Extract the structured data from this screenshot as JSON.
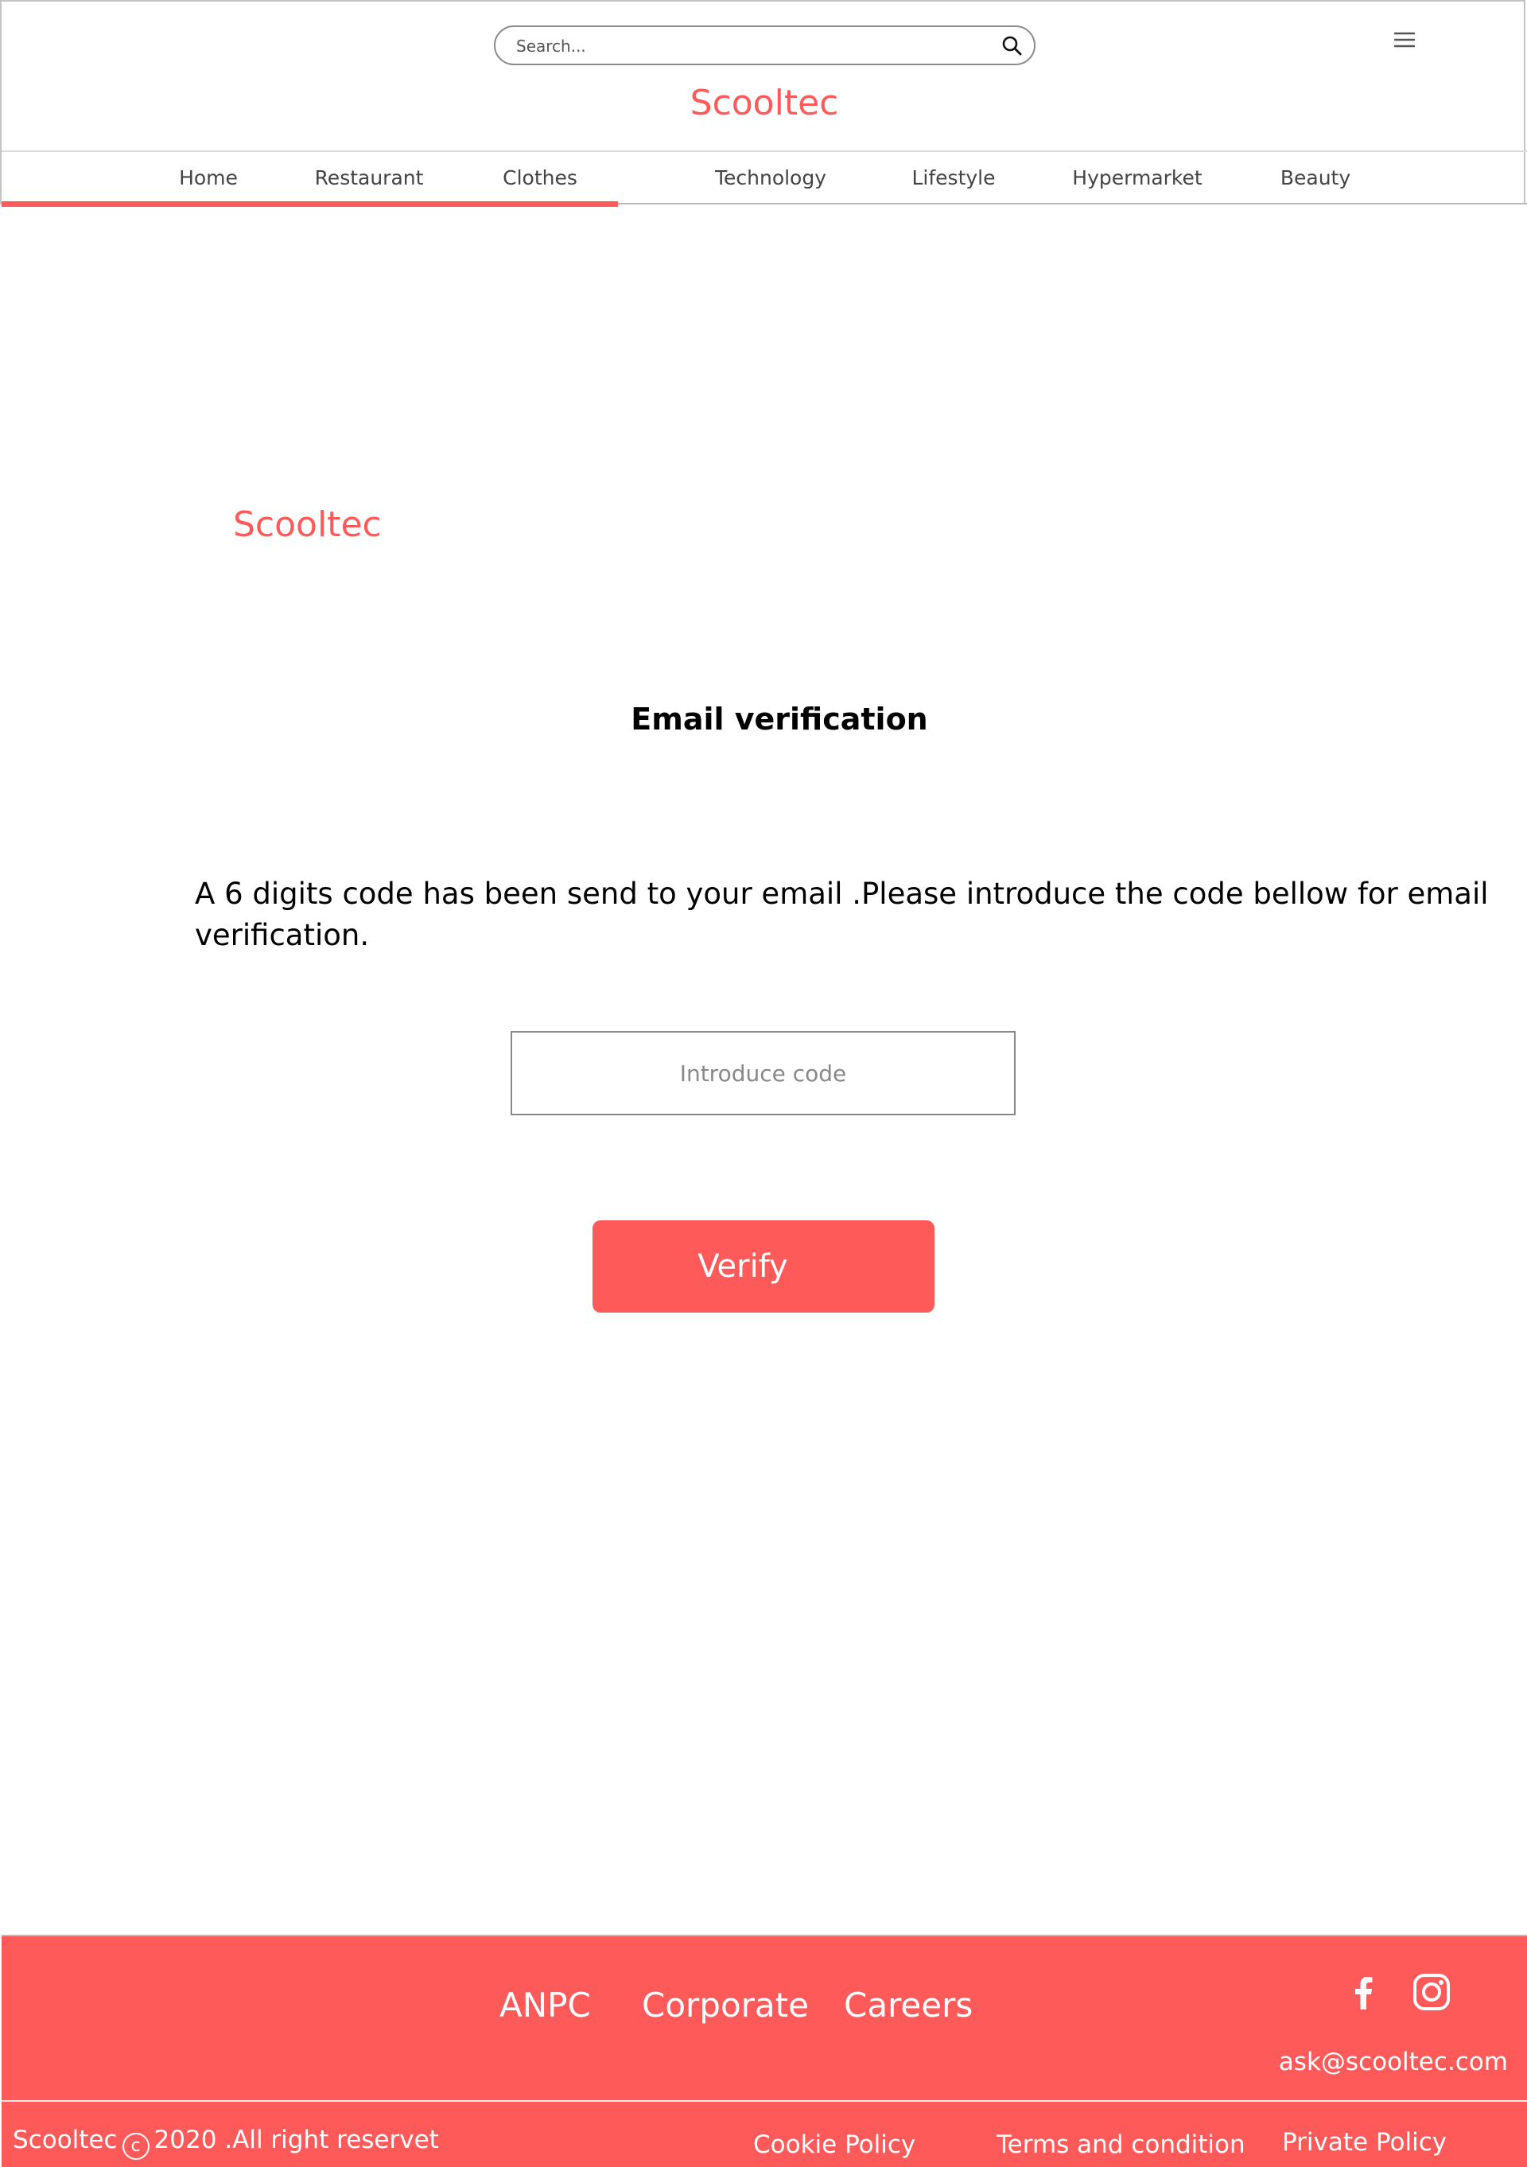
{
  "header": {
    "search": {
      "placeholder": "Search..."
    },
    "brand": "Scooltec"
  },
  "nav": {
    "items": [
      {
        "label": "Home"
      },
      {
        "label": "Restaurant"
      },
      {
        "label": "Clothes"
      },
      {
        "label": "Technology"
      },
      {
        "label": "Lifestyle"
      },
      {
        "label": "Hypermarket"
      },
      {
        "label": "Beauty"
      }
    ]
  },
  "main": {
    "brand": "Scooltec",
    "title": "Email verification",
    "message": "A 6 digits code has been send to your email .Please introduce the code bellow for email verification.",
    "code_input": {
      "placeholder": "Introduce code",
      "value": ""
    },
    "verify_label": "Verify"
  },
  "footer": {
    "links": [
      {
        "label": "ANPC"
      },
      {
        "label": "Corporate"
      },
      {
        "label": "Careers"
      }
    ],
    "email": "ask@scooltec.com",
    "social": [
      "facebook-icon",
      "instagram-icon"
    ],
    "copyright": {
      "brand": "Scooltec",
      "symbol": "c",
      "text": "2020 .All right reservet"
    },
    "legal_links": [
      {
        "label": "Cookie Policy"
      },
      {
        "label": "Terms and condition"
      },
      {
        "label": "Private Policy"
      }
    ]
  },
  "colors": {
    "accent": "#ff5a5a",
    "nav_text": "#444444",
    "border": "#c4c4c4"
  }
}
